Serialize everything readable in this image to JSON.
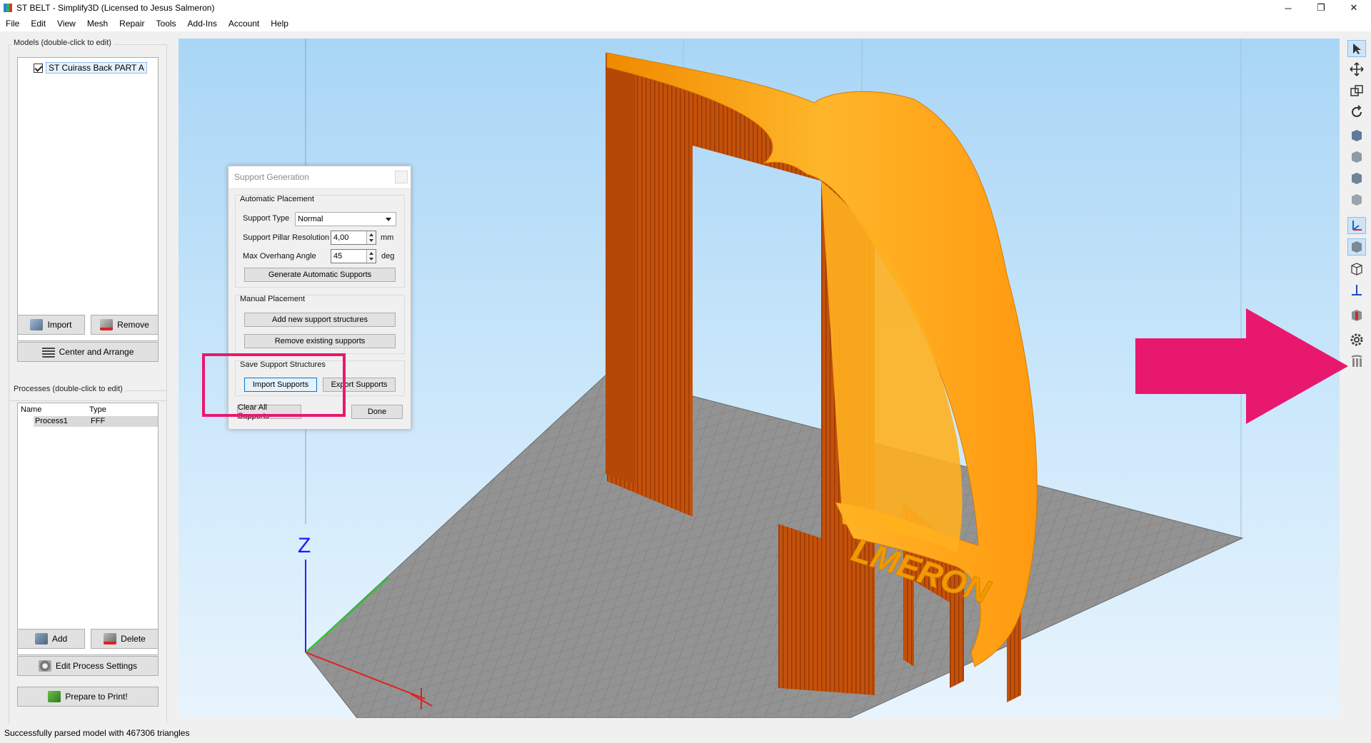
{
  "window": {
    "title": "ST BELT - Simplify3D (Licensed to Jesus Salmeron)",
    "controls": {
      "minimize": "─",
      "maximize": "❐",
      "close": "✕"
    }
  },
  "menu": [
    "File",
    "Edit",
    "View",
    "Mesh",
    "Repair",
    "Tools",
    "Add-Ins",
    "Account",
    "Help"
  ],
  "models": {
    "title": "Models (double-click to edit)",
    "items": [
      {
        "label": "ST Cuirass Back PART A",
        "checked": true
      }
    ],
    "import_label": "Import",
    "remove_label": "Remove",
    "arrange_label": "Center and Arrange"
  },
  "processes": {
    "title": "Processes (double-click to edit)",
    "columns": [
      "Name",
      "Type"
    ],
    "rows": [
      {
        "name": "Process1",
        "type": "FFF"
      }
    ],
    "add_label": "Add",
    "delete_label": "Delete",
    "edit_label": "Edit Process Settings",
    "prepare_label": "Prepare to Print!"
  },
  "status": "Successfully parsed model with 467306 triangles",
  "dialog": {
    "title": "Support Generation",
    "auto": {
      "title": "Automatic Placement",
      "support_type_label": "Support Type",
      "support_type_value": "Normal",
      "pillar_label": "Support Pillar Resolution",
      "pillar_value": "4,00",
      "pillar_unit": "mm",
      "overhang_label": "Max Overhang Angle",
      "overhang_value": "45",
      "overhang_unit": "deg",
      "generate_label": "Generate Automatic Supports"
    },
    "manual": {
      "title": "Manual Placement",
      "add_label": "Add new support structures",
      "remove_label": "Remove existing supports"
    },
    "save": {
      "title": "Save Support Structures",
      "import_label": "Import Supports",
      "export_label": "Export Supports"
    },
    "clear_label": "Clear All Supports",
    "done_label": "Done"
  },
  "viewport": {
    "axis_label": "Z",
    "model_text": "LMERON",
    "colors": {
      "model": "#ffa31a",
      "supports": "#c44a06",
      "bed": "#8f8f8f",
      "annotation": "#e9186f"
    }
  },
  "toolbar_icons": [
    "select-icon",
    "move-icon",
    "scale-icon",
    "rotate-icon",
    "view-default-icon",
    "view-front-icon",
    "view-side-icon",
    "view-top-icon",
    "axes-icon",
    "solid-view-icon",
    "wireframe-view-icon",
    "axis-arrow-icon",
    "cross-section-icon",
    "settings-gear-icon",
    "supports-icon"
  ]
}
